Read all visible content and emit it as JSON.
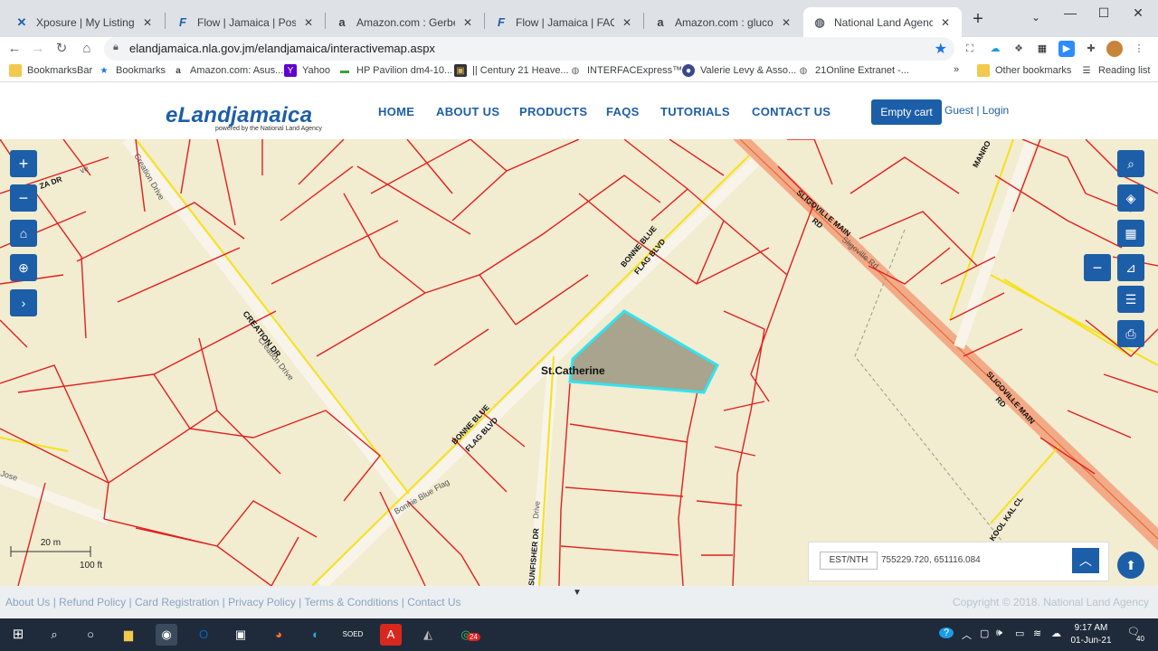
{
  "browser": {
    "tabs": [
      {
        "title": "Xposure | My Listings",
        "icon": "xposure-icon"
      },
      {
        "title": "Flow | Jamaica | Postpaid Pl",
        "icon": "flow-icon"
      },
      {
        "title": "Amazon.com : Gerber fixed",
        "icon": "amazon-icon"
      },
      {
        "title": "Flow | Jamaica | FAQ | billing",
        "icon": "flow-icon"
      },
      {
        "title": "Amazon.com : glucosamine",
        "icon": "amazon-icon"
      },
      {
        "title": "National Land Agency - eLa",
        "icon": "globe-icon"
      }
    ],
    "url": "elandjamaica.nla.gov.jm/elandjamaica/interactivemap.aspx",
    "bookmarks": [
      "BookmarksBar",
      "Bookmarks",
      "Amazon.com: Asus...",
      "Yahoo",
      "HP Pavilion dm4-10...",
      "|| Century 21 Heave...",
      "INTERFACExpress™...",
      "Valerie Levy & Asso...",
      "21Online Extranet -..."
    ],
    "bookmarks_more": "»",
    "other_bookmarks": "Other bookmarks",
    "reading_list": "Reading list"
  },
  "site": {
    "logo": "eLandjamaica",
    "logo_sub": "powered by the National Land Agency",
    "nav": [
      "HOME",
      "ABOUT US",
      "PRODUCTS",
      "FAQS",
      "TUTORIALS",
      "CONTACT US"
    ],
    "cart_label": "Empty cart",
    "login_label": "Guest | Login"
  },
  "map": {
    "labels": {
      "parish": "St.Catherine",
      "creation_dr_top": "Creation Drive",
      "creation_dr_mid": "CREATION DR",
      "creation_drive_mid": "Creation Drive",
      "bonne_blue_top": "BONNE BLUE",
      "flag_blvd_top": "FLAG BLVD",
      "bonne_blue_bot": "BONNE BLUE",
      "flag_blvd_bot": "FLAG BLVD",
      "bonnie_blue_flag": "Bonnie Blue Flag",
      "sligoville_1": "SLIGOVILLE MAIN",
      "sligoville_1b": "RD",
      "sligoville_rd": "Sligoville Rd",
      "sligoville_2": "SLIGOVILLE MAIN",
      "sligoville_2b": "RD",
      "manro": "MANRO",
      "kool_kal": "KOOL KAL CL",
      "sunfisher": "SUNFISHER DR",
      "drive_small": "Drive",
      "za_dr": "ZA DR",
      "jose": "Jose",
      "ve_top": "ve"
    },
    "scale_metric": "20 m",
    "scale_imperial": "100 ft",
    "coord_label": "EST/NTH",
    "coord_value": "755229.720, 651116.084",
    "colors": {
      "land": "#f2ecd0",
      "parcel_line": "#e02020",
      "road_yellow": "#f5e21a",
      "main_road": "#f3a07a",
      "highlight_fill": "#a8a48d",
      "highlight_stroke": "#31e3f0"
    }
  },
  "footer": {
    "links": "About Us | Refund Policy | Card Registration | Privacy Policy | Terms & Conditions | Contact Us",
    "copyright": "Copyright © 2018. National Land Agency",
    "toggle": "▼"
  },
  "taskbar": {
    "time": "9:17 AM",
    "date": "01-Jun-21",
    "badge": "24",
    "notif": "40"
  }
}
